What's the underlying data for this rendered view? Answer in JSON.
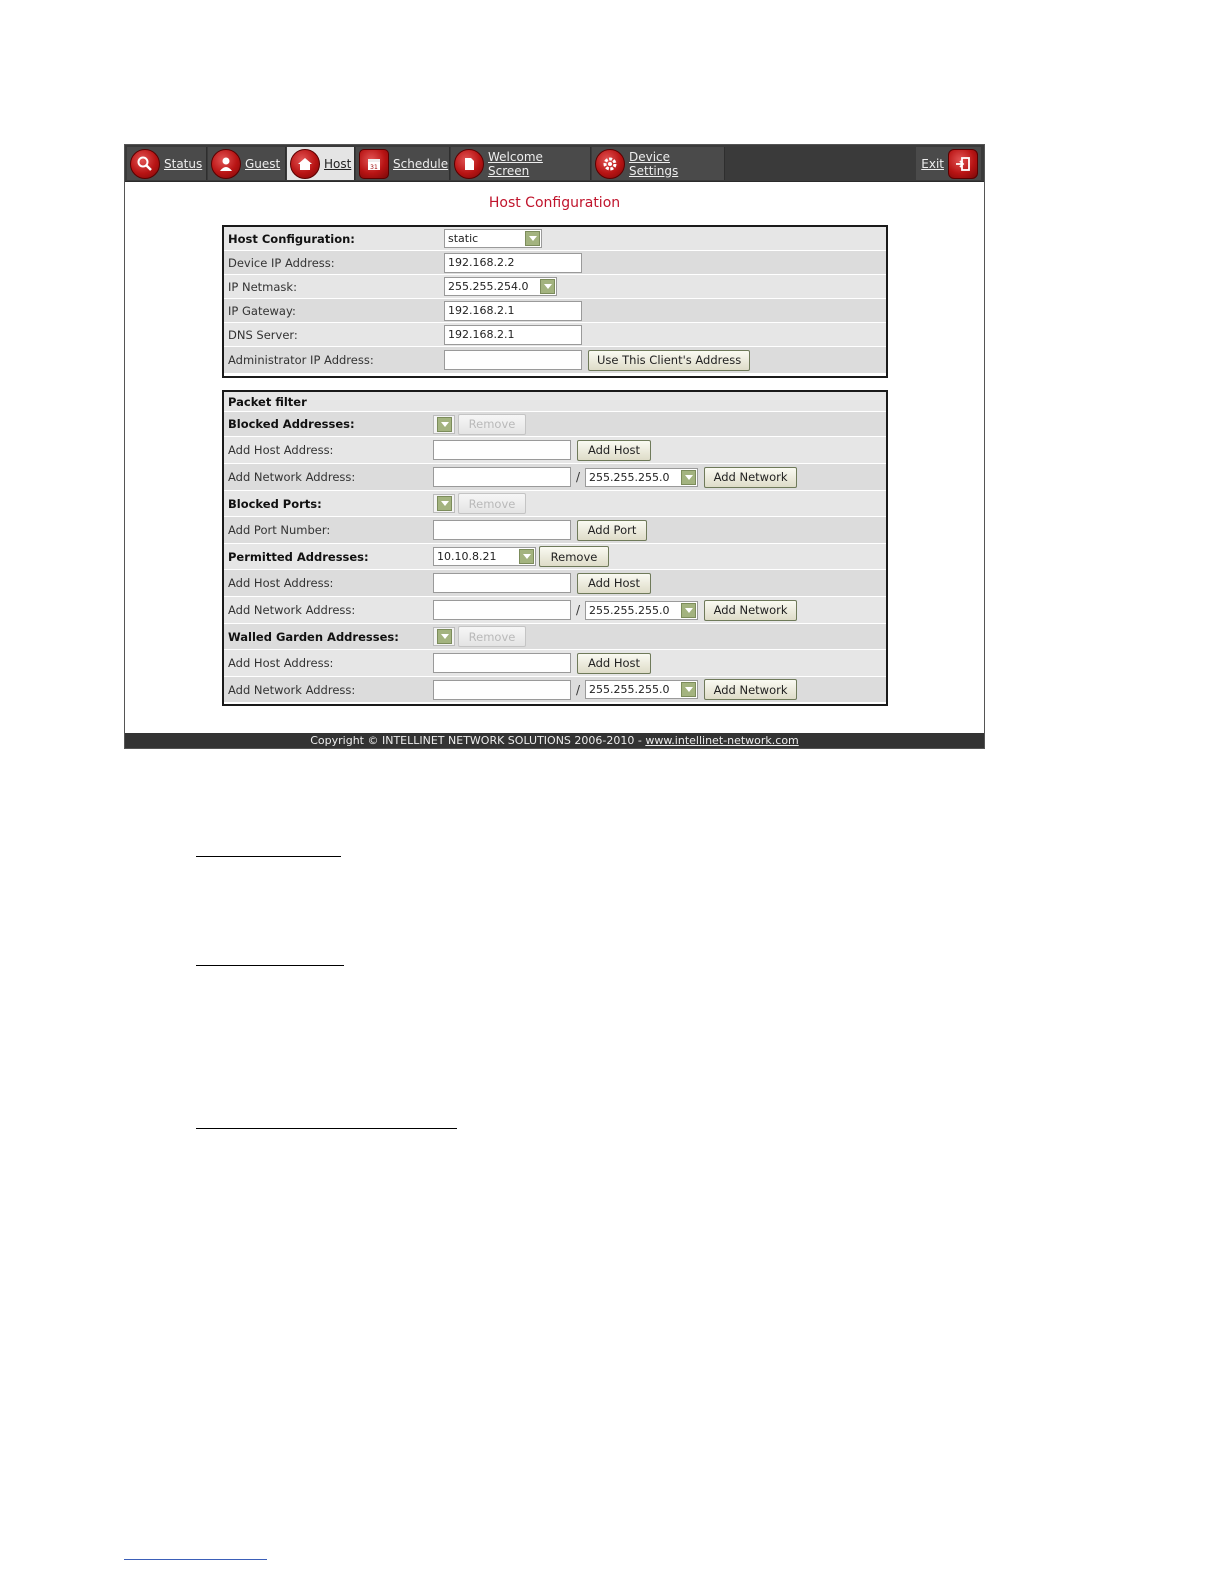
{
  "nav": {
    "items": [
      {
        "label": "Status"
      },
      {
        "label": "Guest"
      },
      {
        "label": "Host"
      },
      {
        "label": "Schedule"
      },
      {
        "label": "Welcome Screen"
      },
      {
        "label": "Device Settings"
      }
    ],
    "exit_label": "Exit",
    "icons": [
      "magnifier-icon",
      "guest-icon",
      "house-icon",
      "calendar-icon",
      "document-icon",
      "gear-icon",
      "exit-door-icon"
    ]
  },
  "page_title": "Host Configuration",
  "host_config": {
    "rows": [
      {
        "label": "Host Configuration:",
        "value": "static"
      },
      {
        "label": "Device IP Address:",
        "value": "192.168.2.2"
      },
      {
        "label": "IP Netmask:",
        "value": "255.255.254.0"
      },
      {
        "label": "IP Gateway:",
        "value": "192.168.2.1"
      },
      {
        "label": "DNS Server:",
        "value": "192.168.2.1"
      },
      {
        "label": "Administrator IP Address:",
        "value": "",
        "button": "Use This Client's Address"
      }
    ]
  },
  "packet_filter": {
    "title": "Packet filter",
    "blocked_addresses_label": "Blocked Addresses:",
    "remove_label": "Remove",
    "add_host_address_label": "Add Host Address:",
    "add_host_button": "Add Host",
    "add_network_address_label": "Add Network Address:",
    "netmask_value": "255.255.255.0",
    "slash": "/",
    "add_network_button": "Add Network",
    "blocked_ports_label": "Blocked Ports:",
    "add_port_number_label": "Add Port Number:",
    "add_port_button": "Add Port",
    "permitted_addresses_label": "Permitted Addresses:",
    "permitted_value": "10.10.8.21",
    "walled_garden_label": "Walled Garden Addresses:"
  },
  "footer": {
    "copyright": "Copyright © INTELLINET NETWORK SOLUTIONS 2006-2010 - ",
    "link": "www.intellinet-network.com"
  },
  "colors": {
    "title_red": "#c0142c",
    "nav_dark": "#3a3a3a",
    "icon_red": "#b81414",
    "select_arrow": "#a3b37f"
  }
}
